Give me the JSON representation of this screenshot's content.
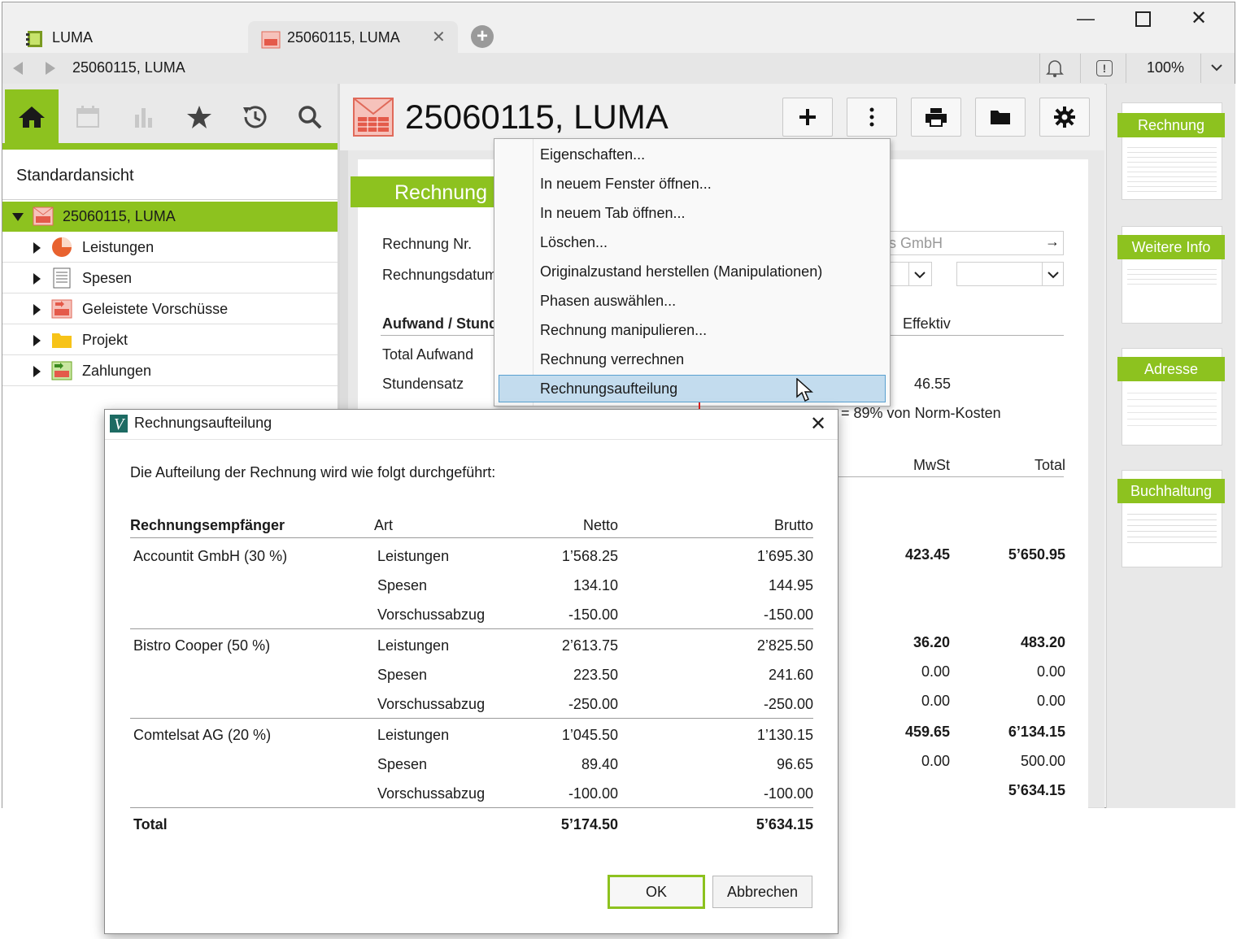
{
  "window": {
    "tab1_title": "LUMA",
    "tab2_title": "25060115, LUMA",
    "zoom": "100%",
    "address": "25060115, LUMA"
  },
  "sidebar": {
    "view_title": "Standardansicht",
    "root": "25060115, LUMA",
    "items": [
      {
        "label": "Leistungen"
      },
      {
        "label": "Spesen"
      },
      {
        "label": "Geleistete Vorschüsse"
      },
      {
        "label": "Projekt"
      },
      {
        "label": "Zahlungen"
      }
    ]
  },
  "main": {
    "title": "25060115, LUMA",
    "section_tab": "Rechnung",
    "field_rechnung_nr": "Rechnung Nr.",
    "field_rechnungsdatum": "Rechnungsdatum",
    "recipient_partial": "s GmbH",
    "aufwand_header": "Aufwand / Stund",
    "effektiv": "Effektiv",
    "total_aufwand": "Total Aufwand",
    "stundensatz": "Stundensatz",
    "stundensatz_value": "46.55",
    "norm_text": "= 89% von Norm-Kosten",
    "col_mwst": "MwSt",
    "col_total": "Total",
    "rows": [
      {
        "mwst": "423.45",
        "total": "5’650.95",
        "bold": true
      },
      {
        "mwst": "36.20",
        "total": "483.20",
        "bold": true
      },
      {
        "mwst": "0.00",
        "total": "0.00",
        "bold": false
      },
      {
        "mwst": "0.00",
        "total": "0.00",
        "bold": false
      },
      {
        "mwst": "459.65",
        "total": "6’134.15",
        "bold": true
      },
      {
        "mwst": "0.00",
        "total": "500.00",
        "bold": false
      },
      {
        "mwst": "",
        "total": "5’634.15",
        "bold": true
      }
    ]
  },
  "thumbnails": [
    "Rechnung",
    "Weitere Info",
    "Adresse",
    "Buchhaltung"
  ],
  "context_menu": {
    "items": [
      "Eigenschaften...",
      "In neuem Fenster öffnen...",
      "In neuem Tab öffnen...",
      "Löschen...",
      "Originalzustand herstellen (Manipulationen)",
      "Phasen auswählen...",
      "Rechnung manipulieren...",
      "Rechnung verrechnen",
      "Rechnungsaufteilung"
    ]
  },
  "dialog": {
    "title": "Rechnungsaufteilung",
    "intro": "Die Aufteilung der Rechnung wird wie folgt durchgeführt:",
    "headers": {
      "recipient": "Rechnungsempfänger",
      "art": "Art",
      "netto": "Netto",
      "brutto": "Brutto"
    },
    "groups": [
      {
        "recipient": "Accountit GmbH (30 %)",
        "rows": [
          {
            "art": "Leistungen",
            "netto": "1’568.25",
            "brutto": "1’695.30"
          },
          {
            "art": "Spesen",
            "netto": "134.10",
            "brutto": "144.95"
          },
          {
            "art": "Vorschussabzug",
            "netto": "-150.00",
            "brutto": "-150.00"
          }
        ]
      },
      {
        "recipient": "Bistro Cooper (50 %)",
        "rows": [
          {
            "art": "Leistungen",
            "netto": "2’613.75",
            "brutto": "2’825.50"
          },
          {
            "art": "Spesen",
            "netto": "223.50",
            "brutto": "241.60"
          },
          {
            "art": "Vorschussabzug",
            "netto": "-250.00",
            "brutto": "-250.00"
          }
        ]
      },
      {
        "recipient": "Comtelsat AG (20 %)",
        "rows": [
          {
            "art": "Leistungen",
            "netto": "1’045.50",
            "brutto": "1’130.15"
          },
          {
            "art": "Spesen",
            "netto": "89.40",
            "brutto": "96.65"
          },
          {
            "art": "Vorschussabzug",
            "netto": "-100.00",
            "brutto": "-100.00"
          }
        ]
      }
    ],
    "total_label": "Total",
    "total_netto": "5’174.50",
    "total_brutto": "5’634.15",
    "ok": "OK",
    "cancel": "Abbrechen"
  },
  "colors": {
    "accent": "#8dc21f",
    "menu_highlight": "#c3dcee",
    "arrow": "#e02020"
  }
}
